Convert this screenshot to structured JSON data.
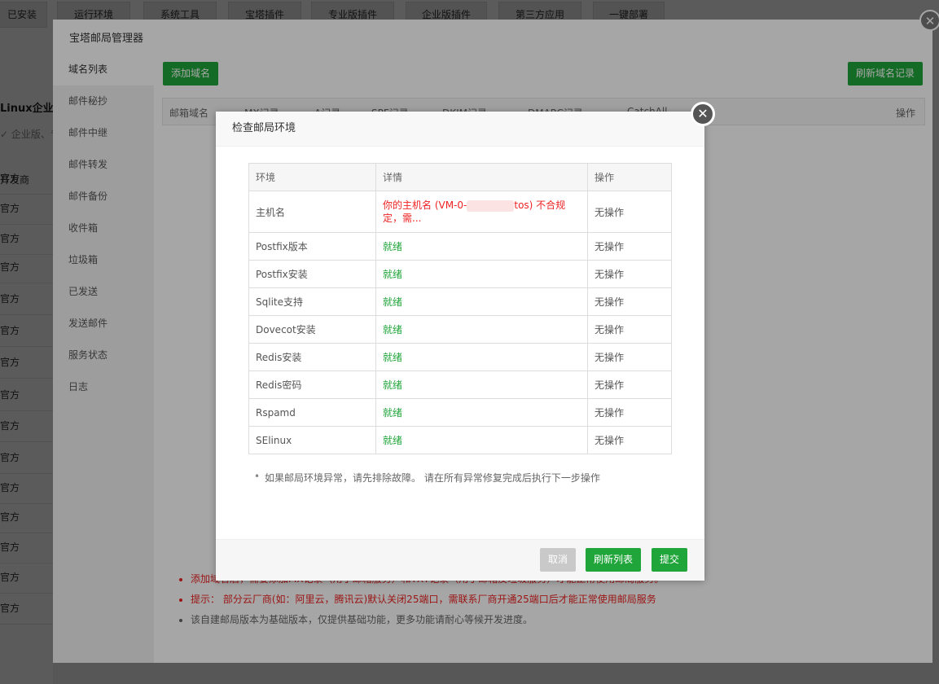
{
  "bg_tabs": [
    "已安装",
    "运行环境",
    "系统工具",
    "宝塔插件",
    "专业版插件",
    "企业版插件",
    "第三方应用",
    "一键部署"
  ],
  "bg_left": {
    "title": "Linux企业版",
    "subtitle": "✓ 企业版、专",
    "header": "开发商",
    "rows": [
      "官方",
      "官方",
      "官方",
      "官方",
      "官方",
      "官方",
      "官方",
      "官方",
      "官方",
      "官方",
      "官方",
      "官方",
      "官方",
      "官方",
      "官方"
    ]
  },
  "window": {
    "title": "宝塔邮局管理器",
    "sidebar": [
      "域名列表",
      "邮件秘抄",
      "邮件中继",
      "邮件转发",
      "邮件备份",
      "收件箱",
      "垃圾箱",
      "已发送",
      "发送邮件",
      "服务状态",
      "日志"
    ],
    "add_domain": "添加域名",
    "refresh_records": "刷新域名记录",
    "columns": [
      "邮箱域名",
      "MX记录",
      "A记录",
      "SPF记录",
      "DKIM记录",
      "DMARC记录",
      "CatchAll",
      "操作"
    ],
    "notes": [
      "添加域名后，需要添加MX记录（用于邮箱服务）和TXT记录（用于邮箱反垃圾服务）才能正常使用邮局服务。",
      "提示： 部分云厂商(如：阿里云，腾讯云)默认关闭25端口，需联系厂商开通25端口后才能正常使用邮局服务",
      "该自建邮局版本为基础版本，仅提供基础功能，更多功能请耐心等候开发进度。"
    ]
  },
  "dialog": {
    "title": "检查邮局环境",
    "headers": [
      "环境",
      "详情",
      "操作"
    ],
    "rows": [
      {
        "env": "主机名",
        "detail": "你的主机名 (VM-0-",
        "detail_tail": "tos) 不合规定，需...",
        "action": "无操作",
        "status": "bad"
      },
      {
        "env": "Postfix版本",
        "detail": "就绪",
        "action": "无操作",
        "status": "ok"
      },
      {
        "env": "Postfix安装",
        "detail": "就绪",
        "action": "无操作",
        "status": "ok"
      },
      {
        "env": "Sqlite支持",
        "detail": "就绪",
        "action": "无操作",
        "status": "ok"
      },
      {
        "env": "Dovecot安装",
        "detail": "就绪",
        "action": "无操作",
        "status": "ok"
      },
      {
        "env": "Redis安装",
        "detail": "就绪",
        "action": "无操作",
        "status": "ok"
      },
      {
        "env": "Redis密码",
        "detail": "就绪",
        "action": "无操作",
        "status": "ok"
      },
      {
        "env": "Rspamd",
        "detail": "就绪",
        "action": "无操作",
        "status": "ok"
      },
      {
        "env": "SElinux",
        "detail": "就绪",
        "action": "无操作",
        "status": "ok"
      }
    ],
    "note": "如果邮局环境异常，请先排除故障。 请在所有异常修复完成后执行下一步操作",
    "cancel": "取消",
    "refresh": "刷新列表",
    "submit": "提交"
  },
  "icons": {
    "close": "close-icon"
  },
  "colors": {
    "green": "#20a53a",
    "red": "#e22222"
  }
}
